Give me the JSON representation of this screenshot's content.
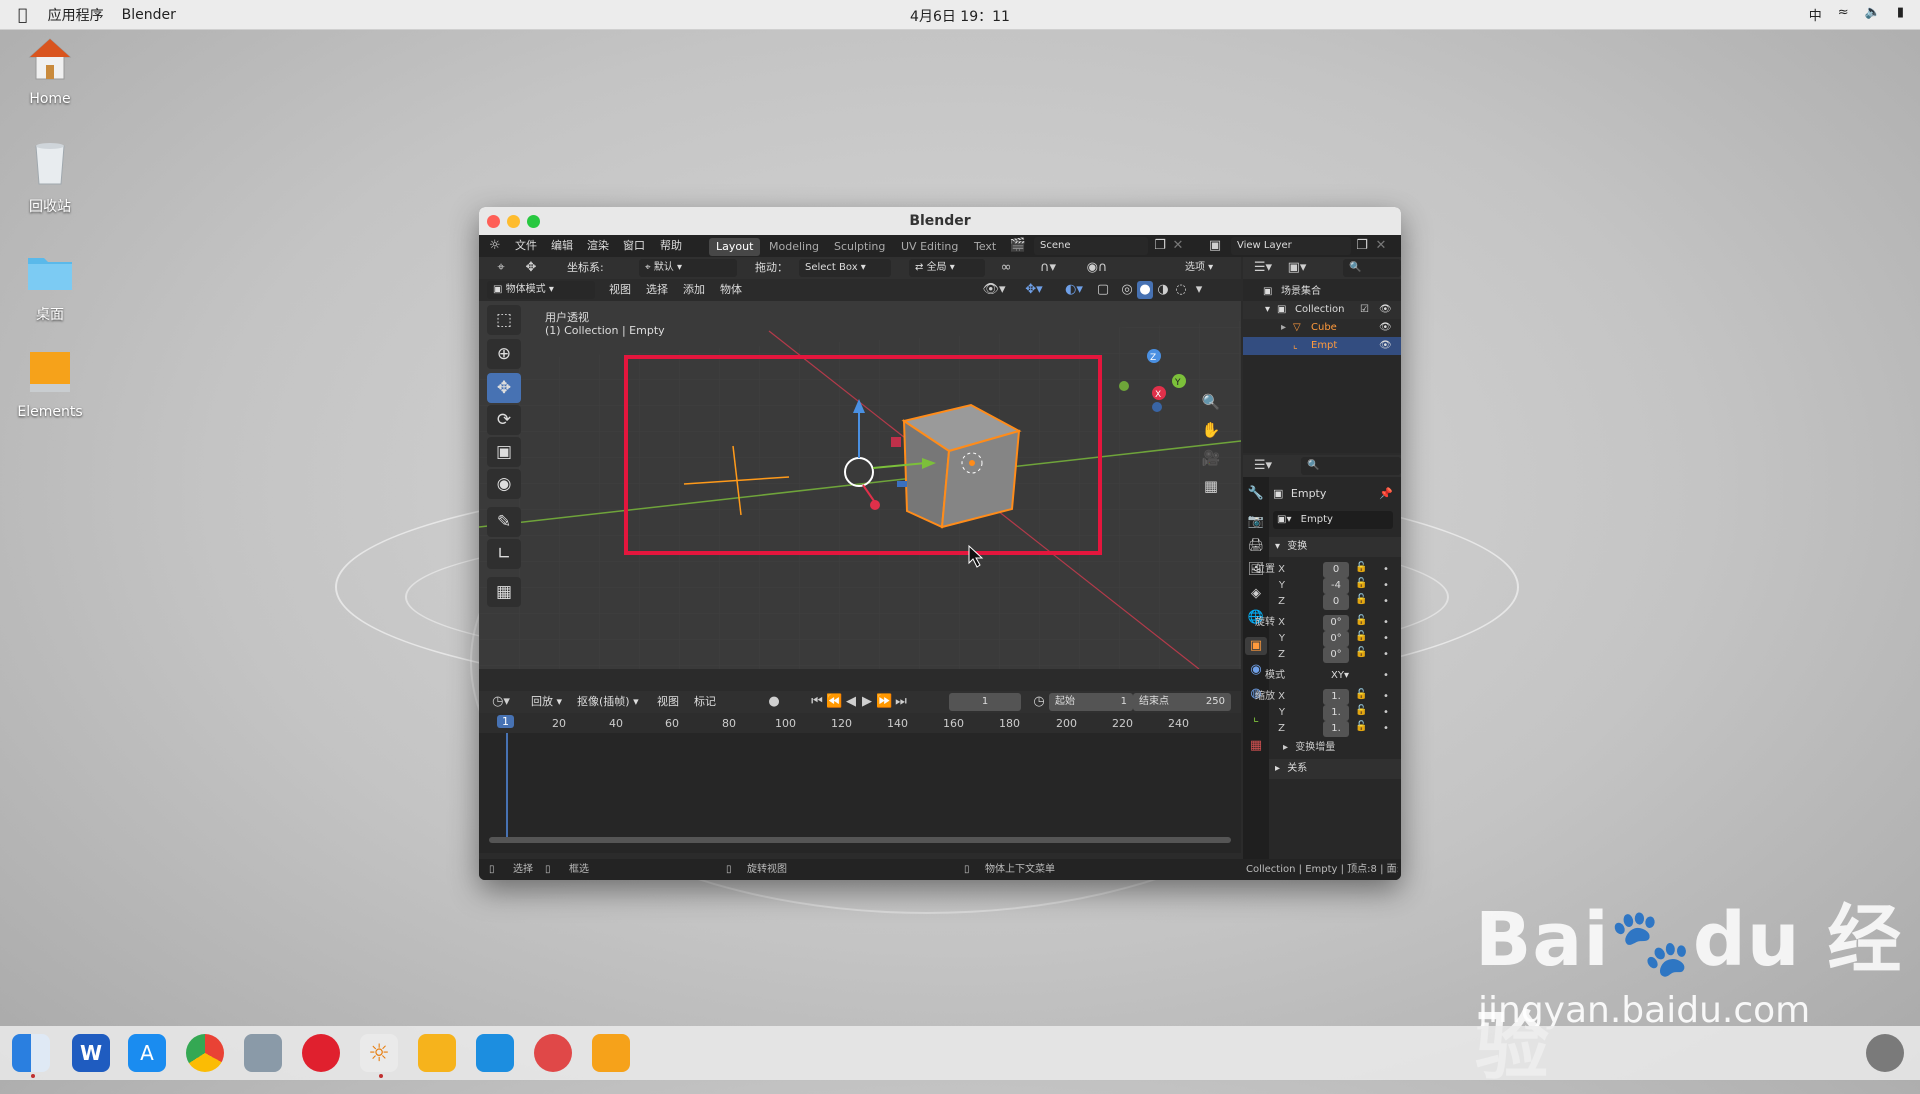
{
  "topbar": {
    "app_menu": "应用程序",
    "app_name": "Blender",
    "clock": "4月6日  19：11",
    "input_method": "中"
  },
  "desktop": {
    "icons": [
      {
        "label": "Home",
        "icon": "home-icon"
      },
      {
        "label": "回收站",
        "icon": "trash-icon"
      },
      {
        "label": "桌面",
        "icon": "folder-icon"
      },
      {
        "label": "Elements",
        "icon": "drive-icon"
      }
    ],
    "watermark_text": "jingyan.baidu.com"
  },
  "window": {
    "title": "Blender"
  },
  "blender": {
    "menus": [
      "文件",
      "编辑",
      "渲染",
      "窗口",
      "帮助"
    ],
    "workspaces": [
      "Layout",
      "Modeling",
      "Sculpting",
      "UV Editing",
      "Text"
    ],
    "active_workspace": "Layout",
    "scene": "Scene",
    "view_layer": "View Layer",
    "header": {
      "coord_label": "坐标系:",
      "coord_value": "默认",
      "drag_label": "拖动：",
      "drag_value": "Select Box",
      "pivot": "全局",
      "options": "选项"
    },
    "viewport_header": {
      "mode": "物体模式",
      "items": [
        "视图",
        "选择",
        "添加",
        "物体"
      ]
    },
    "viewport": {
      "view_name": "用户透视",
      "collection_info": "(1) Collection | Empty"
    },
    "outliner": {
      "scene_collection": "场景集合",
      "collection": "Collection",
      "objects": [
        "Cube",
        "Empt"
      ]
    },
    "properties": {
      "object_name": "Empty",
      "data_name": "Empty",
      "transform_section": "变换",
      "location_label": "位置 X",
      "location": [
        "0",
        "-4",
        "0"
      ],
      "rotation_label": "旋转 X",
      "rotation": [
        "0°",
        "0°",
        "0°"
      ],
      "mode_label": "模式",
      "mode_value": "XY",
      "scale_label": "缩放 X",
      "scale": [
        "1.",
        "1.",
        "1."
      ],
      "axis_y": "Y",
      "axis_z": "Z",
      "delta_section": "变换增量",
      "relations_section": "关系"
    },
    "timeline": {
      "menus": [
        "回放",
        "抠像(插帧)",
        "视图",
        "标记"
      ],
      "current_frame": "1",
      "start_label": "起始",
      "start_value": "1",
      "end_label": "结束点",
      "end_value": "250",
      "ticks": [
        "1",
        "20",
        "40",
        "60",
        "80",
        "100",
        "120",
        "140",
        "160",
        "180",
        "200",
        "220",
        "240"
      ]
    },
    "statusbar": {
      "select": "选择",
      "box_select": "框选",
      "rotate_view": "旋转视图",
      "context_menu": "物体上下文菜单",
      "stats": "Collection | Empty | 顶点:8 | 面:"
    }
  },
  "colors": {
    "highlight_box": "#e4163d",
    "blender_accent": "#4772b3",
    "selected_orange": "#ff8c1a"
  }
}
